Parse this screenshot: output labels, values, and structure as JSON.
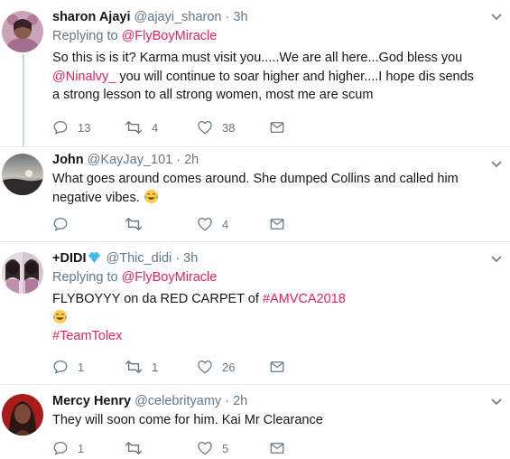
{
  "tweets": [
    {
      "name": "sharon Ajayi",
      "handle": "@ajayi_sharon",
      "separator": "·",
      "time": "3h",
      "replying_label": "Replying to",
      "replying_to": "@FlyBoyMiracle",
      "text_part1": "So this is is it? Karma must visit you.....We are all here...God bless you ",
      "mention": "@Ninalvy_",
      "text_part2": " you will continue to soar higher and higher....I hope dis sends a strong lesson to all strong women, most me are scum",
      "replies": "13",
      "retweets": "4",
      "likes": "38"
    },
    {
      "name": "John",
      "handle": "@KayJay_101",
      "separator": "·",
      "time": "2h",
      "text": "What goes around comes around. She dumped Collins and called him negative vibes.",
      "replies": "",
      "retweets": "",
      "likes": "4"
    },
    {
      "name": "+DIDI",
      "handle": "@Thic_didi",
      "separator": "·",
      "time": "3h",
      "replying_label": "Replying to",
      "replying_to": "@FlyBoyMiracle",
      "text_part1": "FLYBOYYY on da RED CARPET of ",
      "hashtag1": "#AMVCA2018",
      "hashtag2": "#TeamTolex",
      "replies": "1",
      "retweets": "1",
      "likes": "26"
    },
    {
      "name": "Mercy Henry",
      "handle": "@celebrityamy",
      "separator": "·",
      "time": "2h",
      "text": "They will soon come for him. Kai Mr Clearance",
      "replies": "1",
      "retweets": "",
      "likes": "5"
    }
  ],
  "icons": {
    "reply": "reply-icon",
    "retweet": "retweet-icon",
    "like": "heart-icon",
    "dm": "direct-message-icon",
    "caret": "chevron-down-icon",
    "emoji": "tears-of-joy-emoji",
    "verified": "diamond-badge-icon"
  },
  "colors": {
    "link": "#e0245e",
    "secondary_text": "#657786",
    "text": "#14171a",
    "divider": "#e6ecf0",
    "thread_line": "#ccd6dd"
  }
}
